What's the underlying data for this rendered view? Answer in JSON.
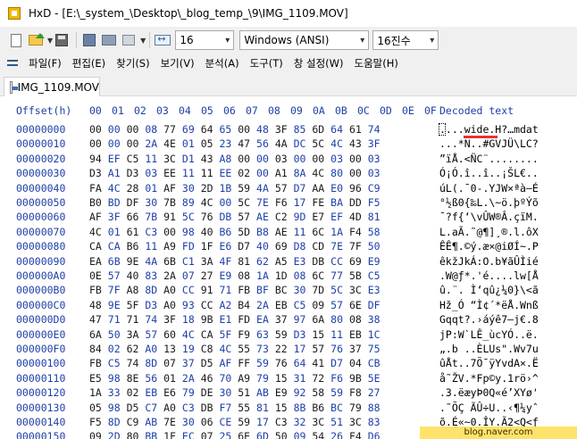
{
  "window": {
    "app": "HxD",
    "title": "HxD - [E:\\_system_\\Desktop\\_blog_temp_\\9\\IMG_1109.MOV]"
  },
  "toolbar": {
    "bytes_per_row": "16",
    "charset": "Windows (ANSI)",
    "offset_base": "16진수"
  },
  "menu": {
    "items": [
      "파일(F)",
      "편집(E)",
      "찾기(S)",
      "보기(V)",
      "분석(A)",
      "도구(T)",
      "창 설정(W)",
      "도움말(H)"
    ]
  },
  "tab": {
    "label": "IMG_1109.MOV"
  },
  "editor": {
    "offset_header": "Offset(h)",
    "column_headers": [
      "00",
      "01",
      "02",
      "03",
      "04",
      "05",
      "06",
      "07",
      "08",
      "09",
      "0A",
      "0B",
      "0C",
      "0D",
      "0E",
      "0F"
    ],
    "decoded_header": "Decoded text",
    "rows": [
      {
        "offset": "00000000",
        "hex": "00 00 00 08 77 69 64 65 00 48 3F 85 6D 64 61 74",
        "text": "....wide.H?…mdat"
      },
      {
        "offset": "00000010",
        "hex": "00 00 00 2A 4E 01 05 23 47 56 4A DC 5C 4C 43 3F",
        "text": "...*N..#GVJÜ\\LC?"
      },
      {
        "offset": "00000020",
        "hex": "94 EF C5 11 3C D1 43 A8 00 00 03 00 00 03 00 03",
        "text": "”ïÅ.<ÑC¨........"
      },
      {
        "offset": "00000030",
        "hex": "D3 A1 D3 03 EE 11 11 EE 02 00 A1 8A 4C 80 00 03",
        "text": "Ó¡Ó.î..î..¡ŠL€.."
      },
      {
        "offset": "00000040",
        "hex": "FA 4C 28 01 AF 30 2D 1B 59 4A 57 D7 AA E0 96 C9",
        "text": "úL(.¯0-.YJW×ªà–É"
      },
      {
        "offset": "00000050",
        "hex": "B0 BD DF 30 7B 89 4C 00 5C 7E F6 17 FE BA DD F5",
        "text": "°½ß0{‰L.\\~ö.þºÝõ"
      },
      {
        "offset": "00000060",
        "hex": "AF 3F 66 7B 91 5C 76 DB 57 AE C2 9D E7 EF 4D 81",
        "text": "¯?f{‘\\vÛW®Â.çïM."
      },
      {
        "offset": "00000070",
        "hex": "4C 01 61 C3 00 98 40 B6 5D B8 AE 11 6C 1A F4 58",
        "text": "L.aÃ.˜@¶]¸®.l.ôX"
      },
      {
        "offset": "00000080",
        "hex": "CA CA B6 11 A9 FD 1F E6 D7 40 69 D8 CD 7E 7F 50",
        "text": "ÊÊ¶.©ý.æ×@iØÍ~.P"
      },
      {
        "offset": "00000090",
        "hex": "EA 6B 9E 4A 6B C1 3A 4F 81 62 A5 E3 DB CC 69 E9",
        "text": "êkžJkÁ:O.b¥ãÛÌié"
      },
      {
        "offset": "000000A0",
        "hex": "0E 57 40 83 2A 07 27 E9 08 1A 1D 08 6C 77 5B C5",
        "text": ".W@ƒ*.'é....lw[Å"
      },
      {
        "offset": "000000B0",
        "hex": "FB 7F A8 8D A0 CC 91 71 FB BF BC 30 7D 5C 3C E3",
        "text": "û.¨. Ì‘qû¿¼0}\\<ã"
      },
      {
        "offset": "000000C0",
        "hex": "48 9E 5F D3 A0 93 CC A2 B4 2A EB C5 09 57 6E DF",
        "text": "Hž_Ó “Ì¢´*ëÅ.Wnß"
      },
      {
        "offset": "000000D0",
        "hex": "47 71 71 74 3F 18 9B E1 FD EA 37 97 6A 80 08 38",
        "text": "Gqqt?.›áýê7—j€.8"
      },
      {
        "offset": "000000E0",
        "hex": "6A 50 3A 57 60 4C CA 5F F9 63 59 D3 15 11 EB 1C",
        "text": "jP:W`LÊ_ùcYÓ..ë."
      },
      {
        "offset": "000000F0",
        "hex": "84 02 62 A0 13 19 C8 4C 55 73 22 17 57 76 37 75",
        "text": "„.b ..ÈLUs\".Wv7u"
      },
      {
        "offset": "00000100",
        "hex": "FB C5 74 8D 07 37 D5 AF FF 59 76 64 41 D7 04 CB",
        "text": "ûÅt..7Õ¯ÿYvdA×.Ë"
      },
      {
        "offset": "00000110",
        "hex": "E5 98 8E 56 01 2A 46 70 A9 79 15 31 72 F6 9B 5E",
        "text": "å˜ŽV.*Fp©y.1rö›^"
      },
      {
        "offset": "00000120",
        "hex": "1A 33 02 EB E6 79 DE 30 51 AB E9 92 58 59 F8 27",
        "text": ".3.ëæyÞ0Q«é’XYø'"
      },
      {
        "offset": "00000130",
        "hex": "05 98 D5 C7 A0 C3 DB F7 55 81 15 8B B6 BC 79 88",
        "text": ".˜ÕÇ ÃÛ÷U..‹¶¼yˆ"
      },
      {
        "offset": "00000140",
        "hex": "F5 8D C9 AB 7E 30 06 CE 59 17 C3 32 3C 51 3C 83",
        "text": "õ.É«~0.ÎY.Ã2<Q<ƒ"
      },
      {
        "offset": "00000150",
        "hex": "09 2D 80 BB 1F EC 07 25 6E 6D 50 09 54 26 F4 D6",
        "text": ".-€».ì.%nmP.T&ôÖ"
      }
    ]
  },
  "watermark": "blog.naver.com"
}
